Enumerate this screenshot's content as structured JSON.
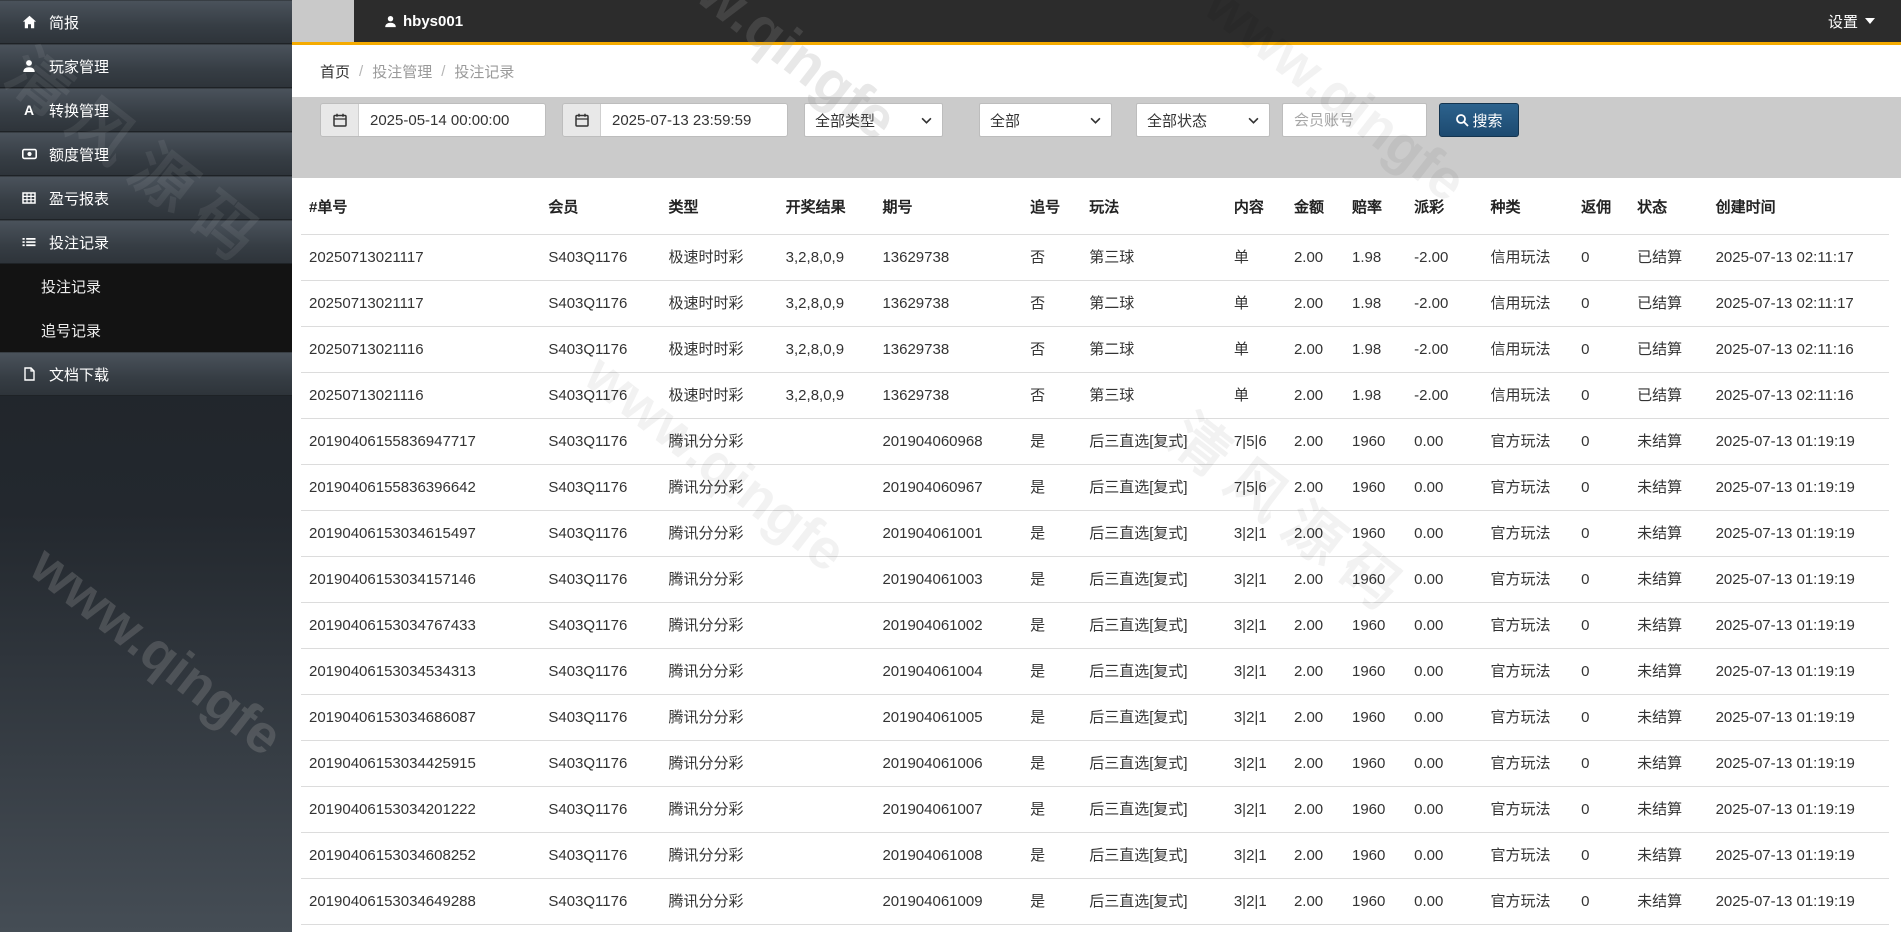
{
  "colors": {
    "topbar_accent": "#f5ab00",
    "search_button": "#1d4a70",
    "sidebar_dark": "#2e343a",
    "filterbar_gray": "#cbcbcb"
  },
  "watermark": {
    "en_text": "www.qingfe",
    "cn_text": "清风源码"
  },
  "topbar": {
    "username": "hbys001",
    "settings_label": "设置"
  },
  "sidebar": {
    "items": [
      {
        "label": "简报",
        "icon": "home-icon"
      },
      {
        "label": "玩家管理",
        "icon": "user-icon"
      },
      {
        "label": "转换管理",
        "icon": "font-icon"
      },
      {
        "label": "额度管理",
        "icon": "credit-icon"
      },
      {
        "label": "盈亏报表",
        "icon": "report-icon"
      },
      {
        "label": "投注记录",
        "icon": "list-icon",
        "expanded": true,
        "children": [
          {
            "label": "投注记录"
          },
          {
            "label": "追号记录"
          }
        ]
      },
      {
        "label": "文档下载",
        "icon": "file-icon"
      }
    ]
  },
  "breadcrumb": {
    "items": [
      "首页",
      "投注管理",
      "投注记录"
    ]
  },
  "filters": {
    "date_from": "2025-05-14 00:00:00",
    "date_to": "2025-07-13 23:59:59",
    "type_select": "全部类型",
    "mode_select": "全部",
    "status_select": "全部状态",
    "account_placeholder": "会员账号",
    "search_label": "搜索"
  },
  "table": {
    "columns": [
      "#单号",
      "会员",
      "类型",
      "开奖结果",
      "期号",
      "追号",
      "玩法",
      "内容",
      "金额",
      "赔率",
      "派彩",
      "种类",
      "返佣",
      "状态",
      "创建时间"
    ],
    "rows": [
      [
        "20250713021117",
        "S403Q1176",
        "极速时时彩",
        "3,2,8,0,9",
        "13629738",
        "否",
        "第三球",
        "单",
        "2.00",
        "1.98",
        "-2.00",
        "信用玩法",
        "0",
        "已结算",
        "2025-07-13 02:11:17"
      ],
      [
        "20250713021117",
        "S403Q1176",
        "极速时时彩",
        "3,2,8,0,9",
        "13629738",
        "否",
        "第二球",
        "单",
        "2.00",
        "1.98",
        "-2.00",
        "信用玩法",
        "0",
        "已结算",
        "2025-07-13 02:11:17"
      ],
      [
        "20250713021116",
        "S403Q1176",
        "极速时时彩",
        "3,2,8,0,9",
        "13629738",
        "否",
        "第二球",
        "单",
        "2.00",
        "1.98",
        "-2.00",
        "信用玩法",
        "0",
        "已结算",
        "2025-07-13 02:11:16"
      ],
      [
        "20250713021116",
        "S403Q1176",
        "极速时时彩",
        "3,2,8,0,9",
        "13629738",
        "否",
        "第三球",
        "单",
        "2.00",
        "1.98",
        "-2.00",
        "信用玩法",
        "0",
        "已结算",
        "2025-07-13 02:11:16"
      ],
      [
        "20190406155836947717",
        "S403Q1176",
        "腾讯分分彩",
        "",
        "201904060968",
        "是",
        "后三直选[复式]",
        "7|5|6",
        "2.00",
        "1960",
        "0.00",
        "官方玩法",
        "0",
        "未结算",
        "2025-07-13 01:19:19"
      ],
      [
        "20190406155836396642",
        "S403Q1176",
        "腾讯分分彩",
        "",
        "201904060967",
        "是",
        "后三直选[复式]",
        "7|5|6",
        "2.00",
        "1960",
        "0.00",
        "官方玩法",
        "0",
        "未结算",
        "2025-07-13 01:19:19"
      ],
      [
        "20190406153034615497",
        "S403Q1176",
        "腾讯分分彩",
        "",
        "201904061001",
        "是",
        "后三直选[复式]",
        "3|2|1",
        "2.00",
        "1960",
        "0.00",
        "官方玩法",
        "0",
        "未结算",
        "2025-07-13 01:19:19"
      ],
      [
        "20190406153034157146",
        "S403Q1176",
        "腾讯分分彩",
        "",
        "201904061003",
        "是",
        "后三直选[复式]",
        "3|2|1",
        "2.00",
        "1960",
        "0.00",
        "官方玩法",
        "0",
        "未结算",
        "2025-07-13 01:19:19"
      ],
      [
        "20190406153034767433",
        "S403Q1176",
        "腾讯分分彩",
        "",
        "201904061002",
        "是",
        "后三直选[复式]",
        "3|2|1",
        "2.00",
        "1960",
        "0.00",
        "官方玩法",
        "0",
        "未结算",
        "2025-07-13 01:19:19"
      ],
      [
        "20190406153034534313",
        "S403Q1176",
        "腾讯分分彩",
        "",
        "201904061004",
        "是",
        "后三直选[复式]",
        "3|2|1",
        "2.00",
        "1960",
        "0.00",
        "官方玩法",
        "0",
        "未结算",
        "2025-07-13 01:19:19"
      ],
      [
        "20190406153034686087",
        "S403Q1176",
        "腾讯分分彩",
        "",
        "201904061005",
        "是",
        "后三直选[复式]",
        "3|2|1",
        "2.00",
        "1960",
        "0.00",
        "官方玩法",
        "0",
        "未结算",
        "2025-07-13 01:19:19"
      ],
      [
        "20190406153034425915",
        "S403Q1176",
        "腾讯分分彩",
        "",
        "201904061006",
        "是",
        "后三直选[复式]",
        "3|2|1",
        "2.00",
        "1960",
        "0.00",
        "官方玩法",
        "0",
        "未结算",
        "2025-07-13 01:19:19"
      ],
      [
        "20190406153034201222",
        "S403Q1176",
        "腾讯分分彩",
        "",
        "201904061007",
        "是",
        "后三直选[复式]",
        "3|2|1",
        "2.00",
        "1960",
        "0.00",
        "官方玩法",
        "0",
        "未结算",
        "2025-07-13 01:19:19"
      ],
      [
        "20190406153034608252",
        "S403Q1176",
        "腾讯分分彩",
        "",
        "201904061008",
        "是",
        "后三直选[复式]",
        "3|2|1",
        "2.00",
        "1960",
        "0.00",
        "官方玩法",
        "0",
        "未结算",
        "2025-07-13 01:19:19"
      ],
      [
        "20190406153034649288",
        "S403Q1176",
        "腾讯分分彩",
        "",
        "201904061009",
        "是",
        "后三直选[复式]",
        "3|2|1",
        "2.00",
        "1960",
        "0.00",
        "官方玩法",
        "0",
        "未结算",
        "2025-07-13 01:19:19"
      ]
    ]
  }
}
